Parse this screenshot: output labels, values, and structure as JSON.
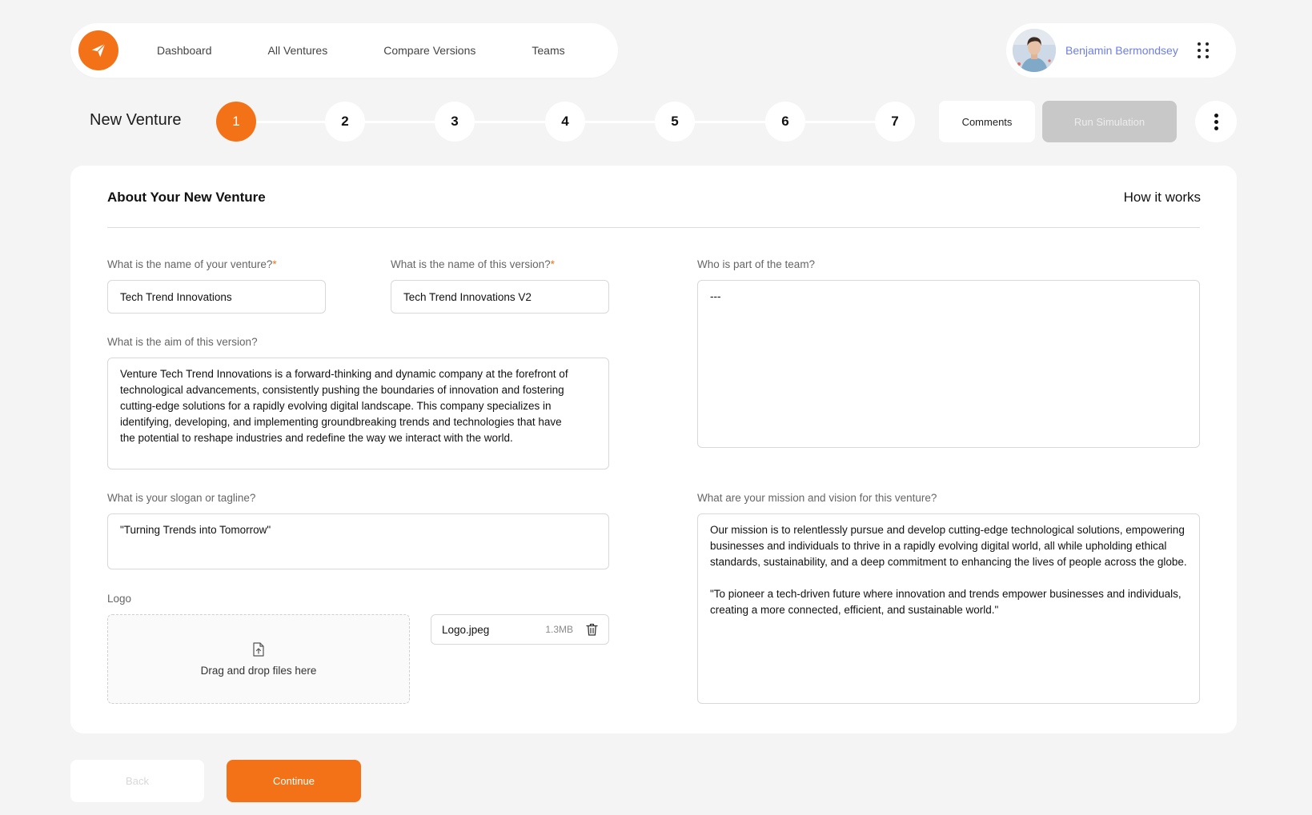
{
  "nav": {
    "items": [
      {
        "label": "Dashboard"
      },
      {
        "label": "All Ventures"
      },
      {
        "label": "Compare Versions"
      },
      {
        "label": "Teams"
      }
    ]
  },
  "user": {
    "name": "Benjamin Bermondsey"
  },
  "page": {
    "title": "New Venture"
  },
  "stepper": {
    "steps": [
      "1",
      "2",
      "3",
      "4",
      "5",
      "6",
      "7"
    ],
    "active": "1"
  },
  "actions": {
    "comments_label": "Comments",
    "run_label": "Run Simulation"
  },
  "card": {
    "title": "About Your New Venture",
    "how_it_works": "How it works"
  },
  "form": {
    "venture_name": {
      "label": "What is the name of your venture?",
      "required_mark": "*",
      "value": "Tech Trend Innovations"
    },
    "version_name": {
      "label": "What is the name of this version?",
      "required_mark": "*",
      "value": "Tech Trend Innovations V2"
    },
    "team": {
      "label": "Who is part of the team?",
      "value": "---"
    },
    "aim": {
      "label": "What is the aim of this version?",
      "value": "Venture Tech Trend Innovations is a forward-thinking and dynamic company at the forefront of technological advancements, consistently pushing the boundaries of innovation and fostering cutting-edge solutions for a rapidly evolving digital landscape. This company specializes in identifying, developing, and implementing groundbreaking trends and technologies that have the potential to reshape industries and redefine the way we interact with the world."
    },
    "slogan": {
      "label": "What is your slogan or tagline?",
      "value": "\"Turning Trends into Tomorrow\""
    },
    "mission": {
      "label": "What are your mission and vision for this venture?",
      "value": "Our mission is to relentlessly pursue and develop cutting-edge technological solutions, empowering businesses and individuals to thrive in a rapidly evolving digital world, all while upholding ethical standards, sustainability, and a deep commitment to enhancing the lives of people across the globe.\n\n\"To pioneer a tech-driven future where innovation and trends empower businesses and individuals, creating a more connected, efficient, and sustainable world.\""
    },
    "logo": {
      "label": "Logo",
      "dropzone_text": "Drag and drop files here",
      "file_name": "Logo.jpeg",
      "file_size": "1.3MB"
    }
  },
  "footer": {
    "back_label": "Back",
    "continue_label": "Continue"
  },
  "colors": {
    "accent": "#f47217",
    "user_name": "#6d7ee6",
    "disabled_button": "#c8c8c8",
    "background": "#f4f4f4"
  },
  "icons": {
    "brand": "paper-plane-icon",
    "user_menu": "grid-dots-icon",
    "more": "vertical-dots-icon",
    "upload": "file-upload-icon",
    "delete": "trash-icon"
  }
}
